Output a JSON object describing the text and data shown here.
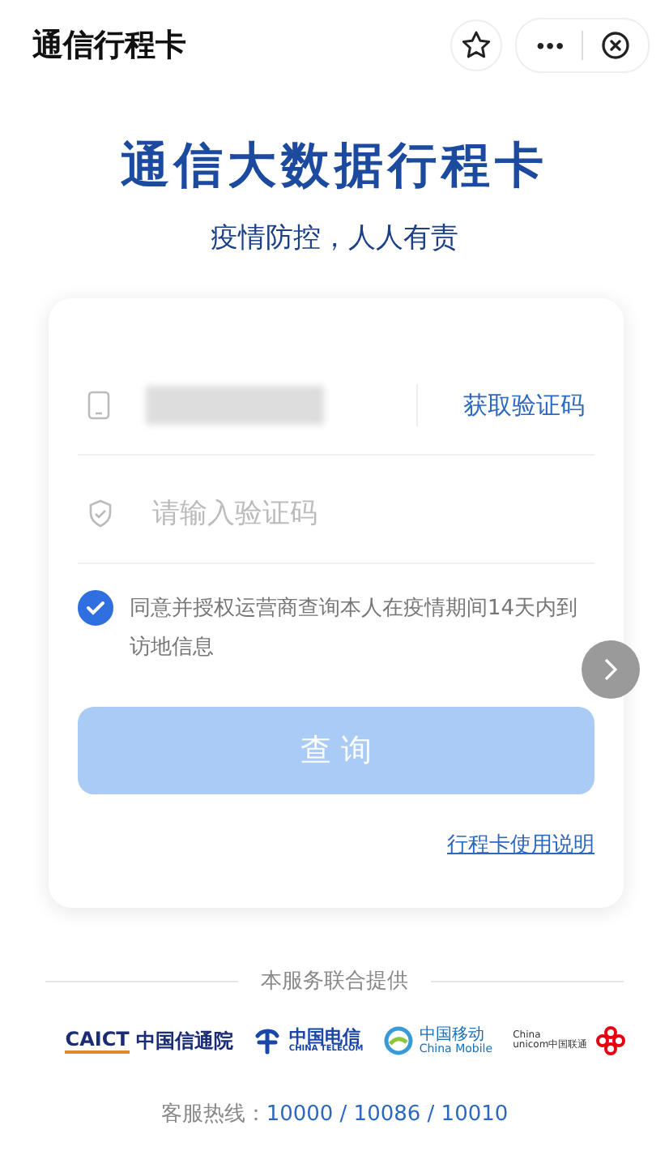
{
  "header": {
    "title": "通信行程卡",
    "more": "•••"
  },
  "hero": {
    "title": "通信大数据行程卡",
    "subtitle": "疫情防控，人人有责"
  },
  "form": {
    "phone": {
      "redacted": true,
      "action": "获取验证码"
    },
    "code": {
      "placeholder": "请输入验证码"
    },
    "agreement": {
      "checked": true,
      "text": "同意并授权运营商查询本人在疫情期间14天内到访地信息"
    },
    "submit": {
      "label": "查 询",
      "disabled": true
    },
    "help_link": "行程卡使用说明"
  },
  "footer": {
    "provided_by": "本服务联合提供",
    "partners": [
      {
        "kind": "caict",
        "texts": [
          "CAICT",
          "中国信通院"
        ]
      },
      {
        "kind": "telecom",
        "texts": [
          "中国电信",
          "CHINA TELECOM"
        ]
      },
      {
        "kind": "mobile",
        "texts": [
          "中国移动",
          "China Mobile"
        ]
      },
      {
        "kind": "unicom",
        "texts": [
          "China",
          "unicom中国联通"
        ]
      }
    ],
    "hotline_label": "客服热线：",
    "hotline": "10000 / 10086 / 10010"
  }
}
